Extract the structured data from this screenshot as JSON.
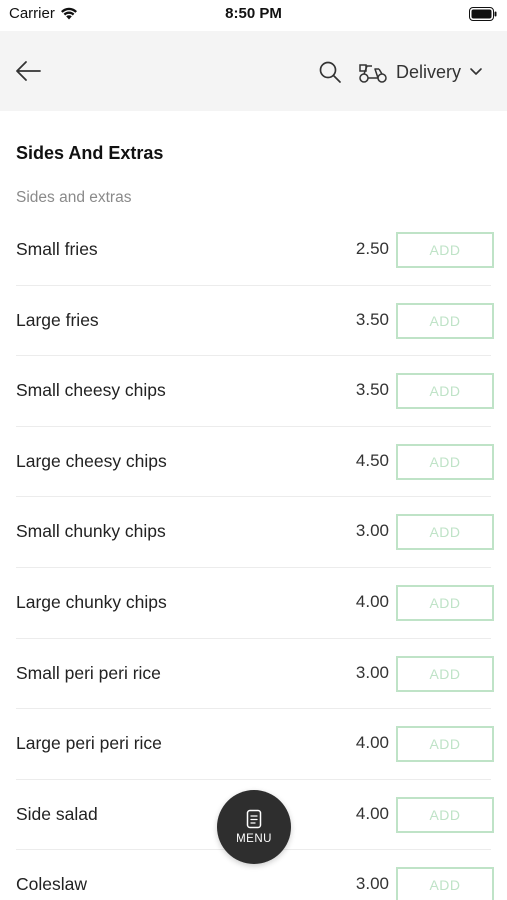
{
  "status_bar": {
    "carrier": "Carrier",
    "time": "8:50 PM"
  },
  "header": {
    "delivery_mode": "Delivery"
  },
  "section": {
    "title": "Sides And Extras",
    "subtitle": "Sides and extras"
  },
  "add_label": "ADD",
  "items": [
    {
      "name": "Small fries",
      "price": "2.50"
    },
    {
      "name": "Large fries",
      "price": "3.50"
    },
    {
      "name": "Small cheesy chips",
      "price": "3.50"
    },
    {
      "name": "Large cheesy chips",
      "price": "4.50"
    },
    {
      "name": "Small chunky chips",
      "price": "3.00"
    },
    {
      "name": "Large chunky chips",
      "price": "4.00"
    },
    {
      "name": "Small peri peri rice",
      "price": "3.00"
    },
    {
      "name": "Large peri peri rice",
      "price": "4.00"
    },
    {
      "name": "Side salad",
      "price": "4.00"
    },
    {
      "name": "Coleslaw",
      "price": "3.00"
    }
  ],
  "fab": {
    "label": "MENU"
  },
  "colors": {
    "add_border": "#bfe3c7",
    "header_bg": "#f4f4f4",
    "fab_bg": "#2e2e2e"
  }
}
